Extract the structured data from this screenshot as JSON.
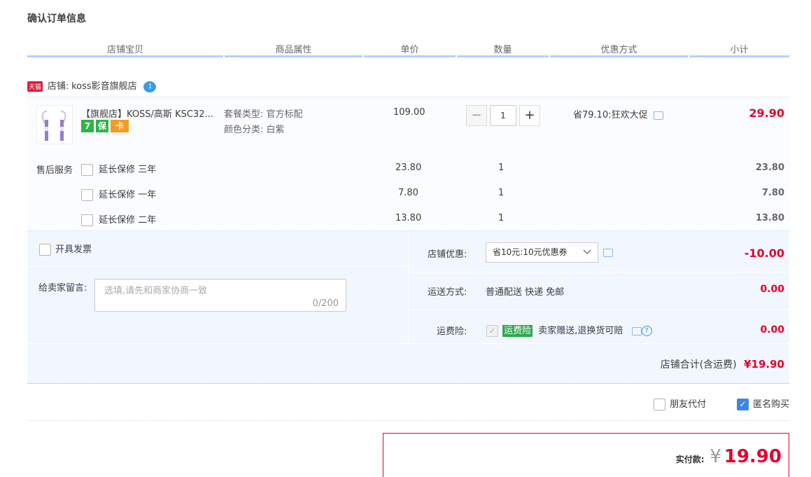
{
  "page": {
    "title": "确认订单信息"
  },
  "columns": [
    "店铺宝贝",
    "商品属性",
    "单价",
    "数量",
    "优惠方式",
    "小计"
  ],
  "shop": {
    "badge": "天猫",
    "label": "店铺:",
    "name": "koss影音旗舰店",
    "chat_badge": "1"
  },
  "item": {
    "name": "【旗舰店】KOSS/高斯 KSC32...",
    "attrs": [
      {
        "k": "套餐类型:",
        "v": "官方标配"
      },
      {
        "k": "颜色分类:",
        "v": "白紫"
      }
    ],
    "price": "109.00",
    "qty": "1",
    "discount": "省79.10:狂欢大促",
    "subtotal": "29.90",
    "badges": [
      {
        "text": "7",
        "color": "#2fb44a"
      },
      {
        "text": "保",
        "color": "#2fb44a"
      },
      {
        "text": "卡",
        "color": "#f39b23"
      }
    ]
  },
  "after_sales": {
    "label": "售后服务",
    "rows": [
      {
        "name": "延长保修 三年",
        "price": "23.80",
        "qty": "1",
        "subtotal": "23.80"
      },
      {
        "name": "延长保修 一年",
        "price": "7.80",
        "qty": "1",
        "subtotal": "7.80"
      },
      {
        "name": "延长保修 二年",
        "price": "13.80",
        "qty": "1",
        "subtotal": "13.80"
      }
    ]
  },
  "invoice": {
    "label": "开具发票"
  },
  "note": {
    "label": "给卖家留言:",
    "placeholder": "选填,请先和商家协商一致",
    "counter": "0/200"
  },
  "shop_discount": {
    "label": "店铺优惠:",
    "selected": "省10元:10元优惠券",
    "amount": "-10.00"
  },
  "shipping": {
    "label": "运送方式:",
    "value": "普通配送 快递 免邮",
    "amount": "0.00"
  },
  "insurance": {
    "label": "运费险:",
    "tag": "运费险",
    "desc": "卖家赠送,退换货可赔",
    "amount": "0.00"
  },
  "shop_total": {
    "label": "店铺合计(含运费)",
    "amount": "¥19.90"
  },
  "options": {
    "friend_pay": "朋友代付",
    "anonymous": "匿名购买"
  },
  "payment": {
    "label": "实付款:",
    "currency": "¥",
    "amount": "19.90"
  },
  "colors": {
    "accent_red": "#e5002d",
    "header_line": "#b2d1ff",
    "panel_bg": "#f2f7ff"
  }
}
